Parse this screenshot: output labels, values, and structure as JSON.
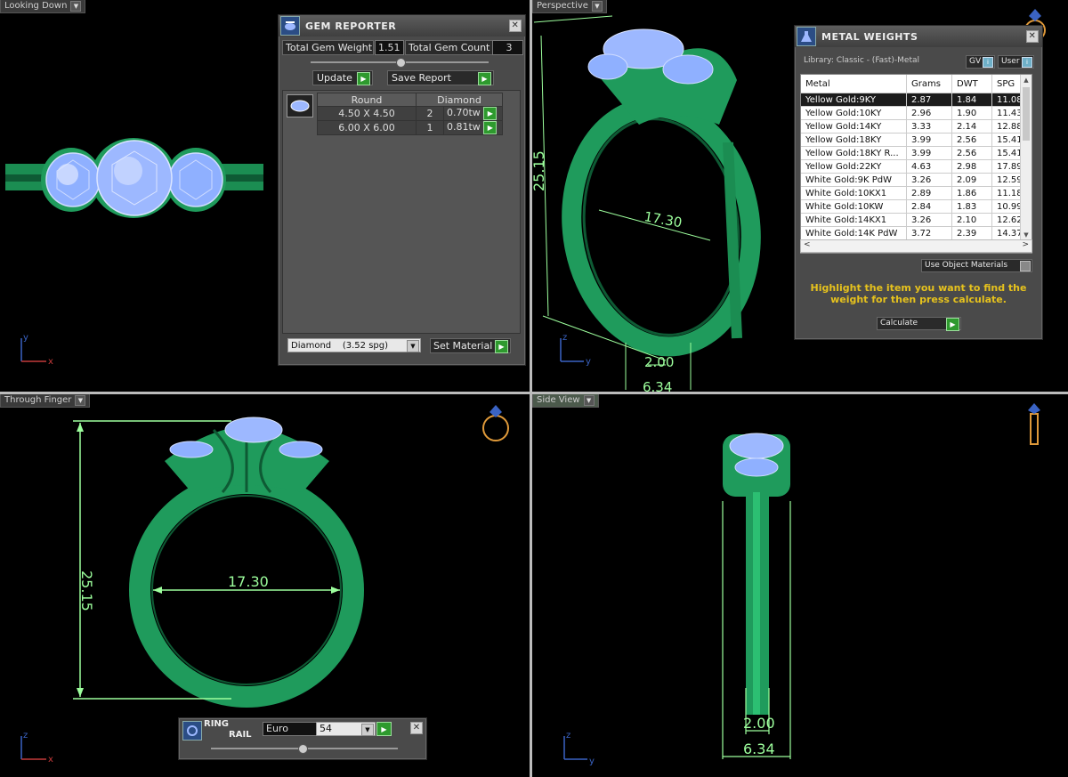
{
  "viewports": {
    "top_left": {
      "label": "Looking Down"
    },
    "top_right": {
      "label": "Perspective",
      "dims": {
        "height": "25.15",
        "inner": "17.30",
        "band_width": "2.00",
        "shank": "6.34"
      }
    },
    "bottom_left": {
      "label": "Through Finger",
      "dims": {
        "height": "25.15",
        "inner": "17.30"
      }
    },
    "bottom_right": {
      "label": "Side View",
      "dims": {
        "band_width": "2.00",
        "shank": "6.34"
      }
    }
  },
  "axes": {
    "x": "x",
    "y": "y",
    "z": "z"
  },
  "gem_reporter": {
    "title": "GEM REPORTER",
    "total_weight_label": "Total Gem Weight",
    "total_weight_value": "1.51",
    "total_count_label": "Total Gem Count",
    "total_count_value": "3",
    "update_label": "Update",
    "save_report_label": "Save Report",
    "table_headers": [
      "Round",
      "Diamond"
    ],
    "rows": [
      {
        "size": "4.50 X 4.50",
        "count": "2",
        "weight": "0.70tw"
      },
      {
        "size": "6.00 X 6.00",
        "count": "1",
        "weight": "0.81tw"
      }
    ],
    "material_select": "Diamond    (3.52 spg)",
    "set_material_label": "Set Material"
  },
  "metal_weights": {
    "title": "METAL WEIGHTS",
    "library": "Library: Classic - (Fast)-Metal",
    "gv_label": "GV",
    "user_label": "User",
    "columns": [
      "Metal",
      "Grams",
      "DWT",
      "SPG"
    ],
    "rows": [
      {
        "metal": "Yellow Gold:9KY",
        "grams": "2.87",
        "dwt": "1.84",
        "spg": "11.08"
      },
      {
        "metal": "Yellow Gold:10KY",
        "grams": "2.96",
        "dwt": "1.90",
        "spg": "11.43"
      },
      {
        "metal": "Yellow Gold:14KY",
        "grams": "3.33",
        "dwt": "2.14",
        "spg": "12.88"
      },
      {
        "metal": "Yellow Gold:18KY",
        "grams": "3.99",
        "dwt": "2.56",
        "spg": "15.41"
      },
      {
        "metal": "Yellow Gold:18KY R...",
        "grams": "3.99",
        "dwt": "2.56",
        "spg": "15.41"
      },
      {
        "metal": "Yellow Gold:22KY",
        "grams": "4.63",
        "dwt": "2.98",
        "spg": "17.89"
      },
      {
        "metal": "White Gold:9K PdW",
        "grams": "3.26",
        "dwt": "2.09",
        "spg": "12.59"
      },
      {
        "metal": "White Gold:10KX1",
        "grams": "2.89",
        "dwt": "1.86",
        "spg": "11.18"
      },
      {
        "metal": "White Gold:10KW",
        "grams": "2.84",
        "dwt": "1.83",
        "spg": "10.99"
      },
      {
        "metal": "White Gold:14KX1",
        "grams": "3.26",
        "dwt": "2.10",
        "spg": "12.62"
      },
      {
        "metal": "White Gold:14K PdW",
        "grams": "3.72",
        "dwt": "2.39",
        "spg": "14.37"
      }
    ],
    "use_object_materials": "Use Object Materials",
    "hint": "Highlight the item you want to find the weight for then press calculate.",
    "calculate_label": "Calculate"
  },
  "ring_rail": {
    "title_line1": "RING",
    "title_line2": "RAIL",
    "standard": "Euro",
    "size": "54"
  },
  "colors": {
    "metal": "#1f9b5c",
    "gem": "#9db8ff",
    "dimension": "#9dff9d",
    "hint": "#e6c21d"
  }
}
